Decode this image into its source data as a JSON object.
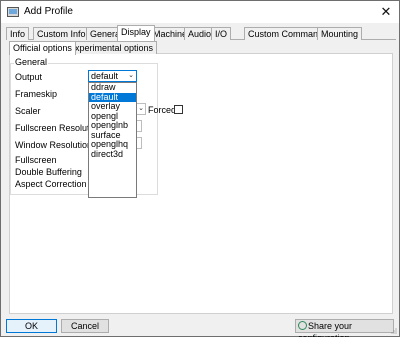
{
  "window": {
    "title": "Add Profile"
  },
  "tabs": [
    {
      "label": "Info"
    },
    {
      "label": "Custom Info"
    },
    {
      "label": "General"
    },
    {
      "label": "Display"
    },
    {
      "label": "Machine"
    },
    {
      "label": "Audio"
    },
    {
      "label": "I/O"
    },
    {
      "label": "Custom Commands"
    },
    {
      "label": "Mounting"
    }
  ],
  "active_tab": "Display",
  "subtabs": [
    {
      "label": "Official options"
    },
    {
      "label": "Experimental options"
    }
  ],
  "active_subtab": "Official options",
  "general": {
    "legend": "General",
    "output_label": "Output",
    "output_value": "default",
    "frameskip_label": "Frameskip",
    "scaler_label": "Scaler",
    "forced_label": "Forced",
    "fullscreen_resolution_label": "Fullscreen Resolution",
    "window_resolution_label": "Window Resolution",
    "fullscreen_label": "Fullscreen",
    "double_buffering_label": "Double Buffering",
    "aspect_correction_label": "Aspect Correction"
  },
  "output_options": [
    "ddraw",
    "default",
    "overlay",
    "opengl",
    "openglnb",
    "surface",
    "openglhq",
    "direct3d"
  ],
  "output_selected": "default",
  "buttons": {
    "ok": "OK",
    "cancel": "Cancel",
    "share": "Share your configuration"
  },
  "colors": {
    "accent": "#0078d7",
    "window_bg": "#f0f0f0",
    "panel_bg": "#ffffff"
  }
}
